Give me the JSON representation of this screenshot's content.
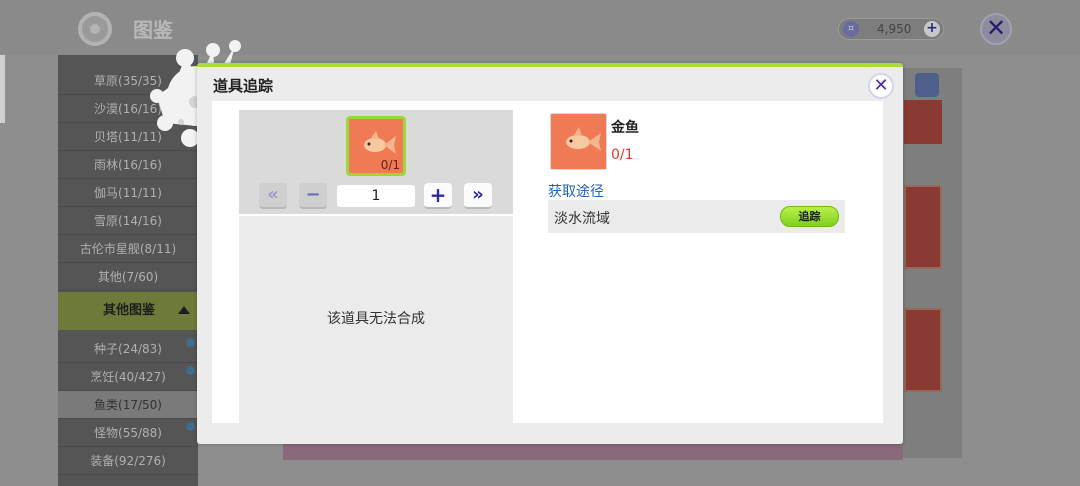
{
  "background": {
    "app_title": "图鉴",
    "coins": "4,950",
    "categories_top": [
      "草原(35/35)",
      "沙漠(16/16)",
      "贝塔(11/11)",
      "雨林(16/16)",
      "伽马(11/11)",
      "雪原(14/16)",
      "古伦市星舰(8/11)",
      "其他(7/60)"
    ],
    "other_header": "其他图鉴",
    "categories_other": [
      "种子(24/83)",
      "烹饪(40/427)",
      "鱼类(17/50)",
      "怪物(55/88)",
      "装备(92/276)"
    ],
    "active_category_index": 2
  },
  "modal": {
    "title": "道具追踪",
    "close_label": "✕",
    "left": {
      "item_count": "0/1",
      "quantity": "1",
      "first_label": "«",
      "minus_label": "−",
      "plus_label": "+",
      "last_label": "»",
      "no_craft_text": "该道具无法合成"
    },
    "right": {
      "item_name": "金鱼",
      "item_count": "0/1",
      "source_title": "获取途径",
      "sources": [
        {
          "name": "淡水流域",
          "action": "追踪"
        }
      ]
    }
  },
  "colors": {
    "accent_green": "#a9dc3b",
    "link_blue": "#1f5fbf",
    "count_red": "#e0382e",
    "item_orange": "#f07a55"
  }
}
